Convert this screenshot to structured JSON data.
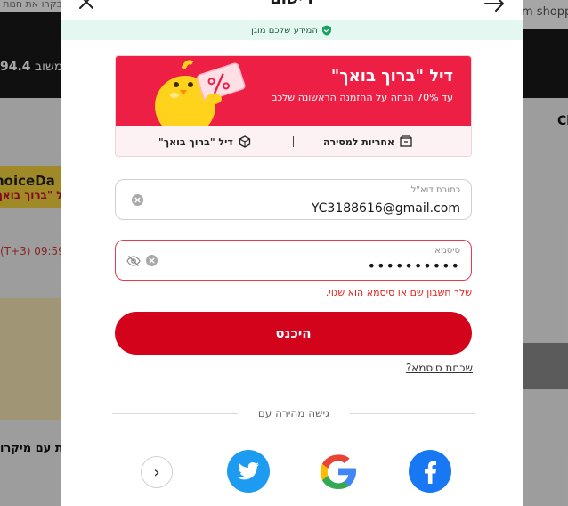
{
  "background": {
    "top_left_text": "בקרו את חנות AliExpress שלך",
    "top_right_text": "m shopp",
    "price": "94.4",
    "price_suffix": "משוב",
    "choice_title": "hoiceDa",
    "choice_sub": "יל \"ברוך בואך\"",
    "time_text": "(T+3) 09:59 ,",
    "bottom_text": "ת עם מיקרו",
    "right_letters": "Cl"
  },
  "modal": {
    "title": "רישום",
    "secure_text": "המידע שלכם מוגן"
  },
  "deal": {
    "title": "דיל \"ברוך בואך\"",
    "subtitle": "עד 70% הנחה על ההזמנה הראשונה שלכם",
    "item_right": "אחריות למסירה",
    "item_left": "דיל \"ברוך בואך\"",
    "mascot_icon": "percent-ticket-chick"
  },
  "email_field": {
    "label": "כתובת דוא\"ל",
    "value": "YC3188616@gmail.com"
  },
  "password_field": {
    "label": "סיסמא",
    "value": "••••••••••"
  },
  "error_message": "שלך חשבון שם או סיסמא הוא שגוי.",
  "login_button": "היכנס",
  "forgot_password": "שכחת סיסמא?",
  "quick_access": "גישה מהירה עם",
  "social": {
    "facebook_icon": "facebook-icon",
    "google_icon": "google-icon",
    "twitter_icon": "twitter-icon",
    "more_glyph": "›"
  },
  "colors": {
    "accent": "#d3031c",
    "deal_red": "#ee1f44",
    "secure_bg": "#e5f7f1",
    "error": "#e1251b"
  }
}
